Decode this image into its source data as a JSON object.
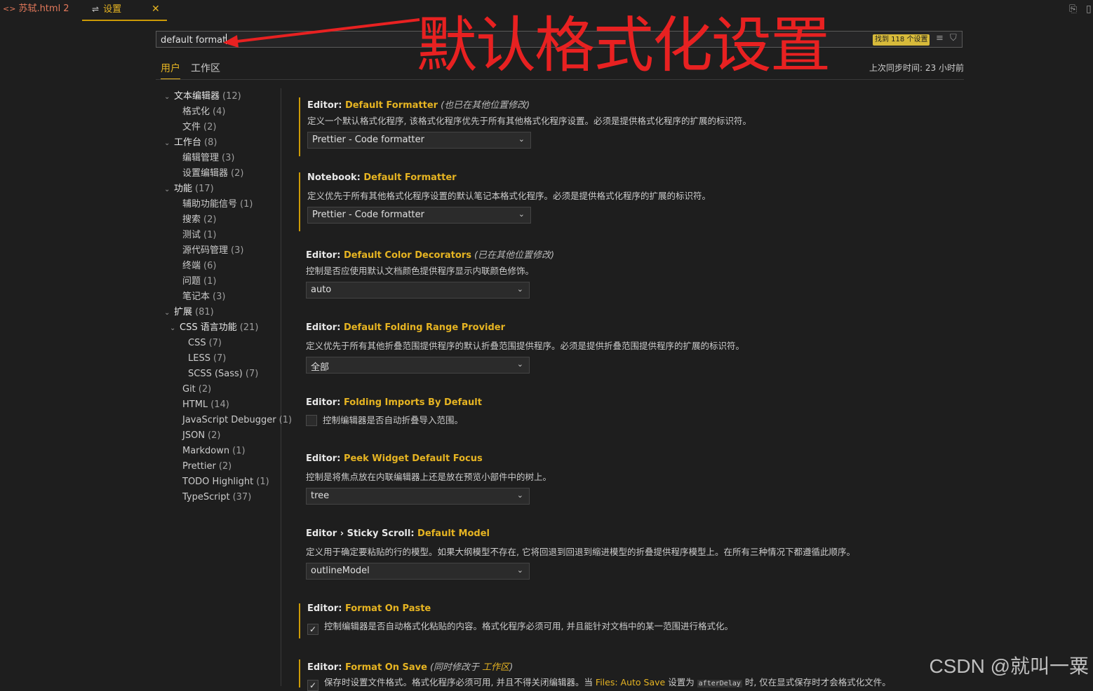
{
  "tabs": [
    {
      "label": "苏轼.html",
      "count": "2",
      "icon": "html-file-icon"
    },
    {
      "label": "设置",
      "icon": "settings-icon",
      "close": "✕"
    }
  ],
  "search": {
    "value": "default format",
    "results": "找到 118 个设置"
  },
  "scopes": {
    "user": "用户",
    "workspace": "工作区"
  },
  "sync_status": "上次同步时间: 23 小时前",
  "annotation": "默认格式化设置",
  "toc": [
    {
      "label": "文本编辑器",
      "count": "(12)",
      "chev": "⌵"
    },
    {
      "label": "格式化",
      "count": "(4)"
    },
    {
      "label": "文件",
      "count": "(2)"
    },
    {
      "label": "工作台",
      "count": "(8)",
      "chev": "⌵"
    },
    {
      "label": "编辑管理",
      "count": "(3)"
    },
    {
      "label": "设置编辑器",
      "count": "(2)"
    },
    {
      "label": "功能",
      "count": "(17)",
      "chev": "⌵"
    },
    {
      "label": "辅助功能信号",
      "count": "(1)"
    },
    {
      "label": "搜索",
      "count": "(2)"
    },
    {
      "label": "测试",
      "count": "(1)"
    },
    {
      "label": "源代码管理",
      "count": "(3)"
    },
    {
      "label": "终端",
      "count": "(6)"
    },
    {
      "label": "问题",
      "count": "(1)"
    },
    {
      "label": "笔记本",
      "count": "(3)"
    },
    {
      "label": "扩展",
      "count": "(81)",
      "chev": "⌵"
    },
    {
      "label": "CSS 语言功能",
      "count": "(21)",
      "chev": "⌵"
    },
    {
      "label": "CSS",
      "count": "(7)"
    },
    {
      "label": "LESS",
      "count": "(7)"
    },
    {
      "label": "SCSS (Sass)",
      "count": "(7)"
    },
    {
      "label": "Git",
      "count": "(2)"
    },
    {
      "label": "HTML",
      "count": "(14)"
    },
    {
      "label": "JavaScript Debugger",
      "count": "(1)"
    },
    {
      "label": "JSON",
      "count": "(2)"
    },
    {
      "label": "Markdown",
      "count": "(1)"
    },
    {
      "label": "Prettier",
      "count": "(2)"
    },
    {
      "label": "TODO Highlight",
      "count": "(1)"
    },
    {
      "label": "TypeScript",
      "count": "(37)"
    }
  ],
  "settings": [
    {
      "prefix": "Editor: ",
      "key": "Default Formatter",
      "note": "(也已在其他位置修改)",
      "desc": "定义一个默认格式化程序, 该格式化程序优先于所有其他格式化程序设置。必须是提供格式化程序的扩展的标识符。",
      "value": "Prettier - Code formatter"
    },
    {
      "prefix": "Notebook: ",
      "key": "Default Formatter",
      "desc": "定义优先于所有其他格式化程序设置的默认笔记本格式化程序。必须是提供格式化程序的扩展的标识符。",
      "value": "Prettier - Code formatter"
    },
    {
      "prefix": "Editor: ",
      "key": "Default Color Decorators",
      "note": "(已在其他位置修改)",
      "desc": "控制是否应使用默认文档颜色提供程序显示内联颜色修饰。",
      "value": "auto"
    },
    {
      "prefix": "Editor: ",
      "key": "Default Folding Range Provider",
      "desc": "定义优先于所有其他折叠范围提供程序的默认折叠范围提供程序。必须是提供折叠范围提供程序的扩展的标识符。",
      "value": "全部"
    },
    {
      "prefix": "Editor: ",
      "key": "Folding Imports By Default",
      "desc": "控制编辑器是否自动折叠导入范围。"
    },
    {
      "prefix": "Editor: ",
      "key": "Peek Widget Default Focus",
      "desc": "控制是将焦点放在内联编辑器上还是放在预览小部件中的树上。",
      "value": "tree"
    },
    {
      "prefix": "Editor › Sticky Scroll: ",
      "key": "Default Model",
      "desc": "定义用于确定要粘贴的行的模型。如果大纲模型不存在, 它将回退到回退到缩进模型的折叠提供程序模型上。在所有三种情况下都遵循此顺序。",
      "value": "outlineModel"
    },
    {
      "prefix": "Editor: ",
      "key": "Format On Paste",
      "desc": "控制编辑器是否自动格式化粘贴的内容。格式化程序必须可用, 并且能针对文档中的某一范围进行格式化。"
    },
    {
      "prefix": "Editor: ",
      "key": "Format On Save",
      "note_a": "(同时修改于 ",
      "note_link": "工作区",
      "note_b": ")",
      "desc_a": "保存时设置文件格式。格式化程序必须可用, 并且不得关闭编辑器。当 ",
      "desc_link": "Files: Auto Save",
      "desc_b": " 设置为 ",
      "desc_code": "afterDelay",
      "desc_c": " 时, 仅在显式保存时才会格式化文件。"
    }
  ],
  "watermark": "CSDN @就叫一粟",
  "colors": {
    "accent": "#e6b422",
    "annotation": "#e82121",
    "background": "#1e1e1e"
  }
}
